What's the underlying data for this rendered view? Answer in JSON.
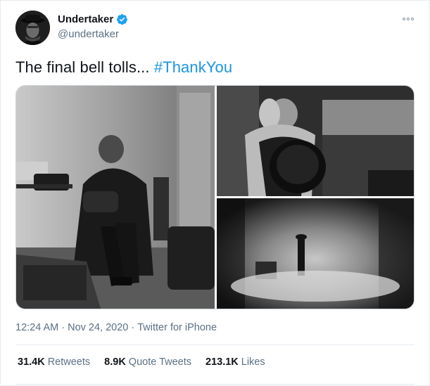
{
  "tweet": {
    "author": {
      "display_name": "Undertaker",
      "handle": "@undertaker",
      "verified": true,
      "avatar_icon": "avatar-undertaker"
    },
    "text": "The final bell tolls... ",
    "hashtag": "#ThankYou",
    "media": [
      {
        "name": "photo-locker-room",
        "icon": "photo"
      },
      {
        "name": "photo-embrace-hat",
        "icon": "photo"
      },
      {
        "name": "photo-fog-entrance",
        "icon": "photo"
      }
    ],
    "timestamp": "12:24 AM",
    "date": "Nov 24, 2020",
    "separator": "·",
    "source": "Twitter for iPhone",
    "stats": [
      {
        "count": "31.4K",
        "label": "Retweets"
      },
      {
        "count": "8.9K",
        "label": "Quote Tweets"
      },
      {
        "count": "213.1K",
        "label": "Likes"
      }
    ]
  },
  "colors": {
    "link": "#1b95e0",
    "verified": "#1da1f2",
    "secondary_text": "#5b7083",
    "divider": "#e6ecf0"
  }
}
